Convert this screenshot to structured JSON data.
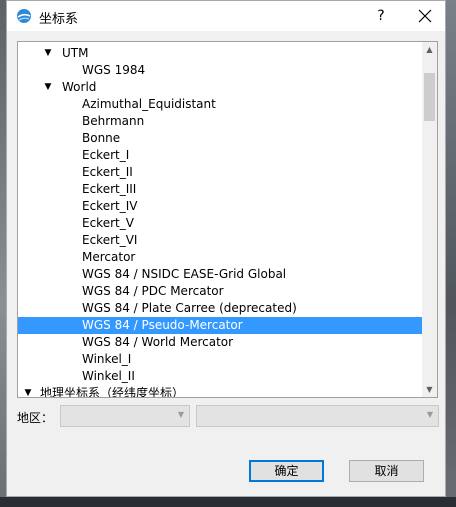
{
  "window": {
    "title": "坐标系",
    "help_label": "?"
  },
  "tree": {
    "rows": [
      {
        "label": "UTM",
        "level": 1,
        "expander": "expanded"
      },
      {
        "label": "WGS 1984",
        "level": 2,
        "expander": "none"
      },
      {
        "label": "World",
        "level": 1,
        "expander": "expanded"
      },
      {
        "label": "Azimuthal_Equidistant",
        "level": 2,
        "expander": "none"
      },
      {
        "label": "Behrmann",
        "level": 2,
        "expander": "none"
      },
      {
        "label": "Bonne",
        "level": 2,
        "expander": "none"
      },
      {
        "label": "Eckert_I",
        "level": 2,
        "expander": "none"
      },
      {
        "label": "Eckert_II",
        "level": 2,
        "expander": "none"
      },
      {
        "label": "Eckert_III",
        "level": 2,
        "expander": "none"
      },
      {
        "label": "Eckert_IV",
        "level": 2,
        "expander": "none"
      },
      {
        "label": "Eckert_V",
        "level": 2,
        "expander": "none"
      },
      {
        "label": "Eckert_VI",
        "level": 2,
        "expander": "none"
      },
      {
        "label": "Mercator",
        "level": 2,
        "expander": "none"
      },
      {
        "label": "WGS 84 / NSIDC EASE-Grid Global",
        "level": 2,
        "expander": "none"
      },
      {
        "label": "WGS 84 / PDC Mercator",
        "level": 2,
        "expander": "none"
      },
      {
        "label": "WGS 84 / Plate Carree (deprecated)",
        "level": 2,
        "expander": "none"
      },
      {
        "label": "WGS 84 / Pseudo-Mercator",
        "level": 2,
        "expander": "none",
        "selected": true
      },
      {
        "label": "WGS 84 / World Mercator",
        "level": 2,
        "expander": "none"
      },
      {
        "label": "Winkel_I",
        "level": 2,
        "expander": "none"
      },
      {
        "label": "Winkel_II",
        "level": 2,
        "expander": "none"
      },
      {
        "label": "地理坐标系（经纬度坐标）",
        "level": 0,
        "expander": "expanded"
      }
    ],
    "selected_color": "#3399ff",
    "scroll_position": 0.05
  },
  "region": {
    "label": "地区：",
    "combo1_value": "",
    "combo2_value": ""
  },
  "buttons": {
    "ok_label": "确定",
    "cancel_label": "取消"
  }
}
